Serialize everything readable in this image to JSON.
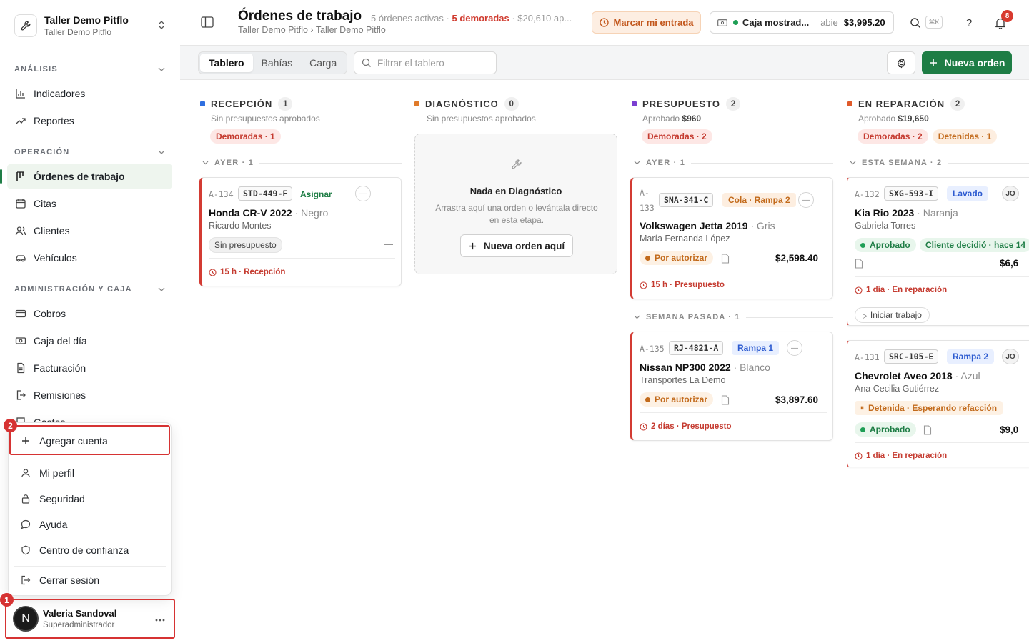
{
  "workspace": {
    "name": "Taller Demo Pitflo",
    "sub": "Taller Demo Pitflo"
  },
  "sidebar": {
    "sections": [
      {
        "label": "ANÁLISIS"
      },
      {
        "label": "OPERACIÓN"
      },
      {
        "label": "ADMINISTRACIÓN Y CAJA"
      }
    ],
    "items": [
      {
        "label": "Indicadores",
        "icon": "chart-icon"
      },
      {
        "label": "Reportes",
        "icon": "trend-icon"
      },
      {
        "label": "Órdenes de trabajo",
        "icon": "kanban-icon",
        "active": true
      },
      {
        "label": "Citas",
        "icon": "calendar-icon"
      },
      {
        "label": "Clientes",
        "icon": "users-icon"
      },
      {
        "label": "Vehículos",
        "icon": "car-icon"
      },
      {
        "label": "Cobros",
        "icon": "card-icon"
      },
      {
        "label": "Caja del día",
        "icon": "cash-icon"
      },
      {
        "label": "Facturación",
        "icon": "file-icon"
      },
      {
        "label": "Remisiones",
        "icon": "export-icon"
      },
      {
        "label": "Gastos",
        "icon": "receipt-icon"
      }
    ]
  },
  "account_menu": {
    "add_account": "Agregar cuenta",
    "items": [
      "Mi perfil",
      "Seguridad",
      "Ayuda",
      "Centro de confianza"
    ],
    "logout": "Cerrar sesión"
  },
  "user": {
    "initial": "N",
    "name": "Valeria Sandoval",
    "role": "Superadministrador"
  },
  "annotations": {
    "first": "1",
    "second": "2"
  },
  "header": {
    "title": "Órdenes de trabajo",
    "breadcrumb": "Taller Demo Pitflo › Taller Demo Pitflo",
    "active": "5 órdenes activas",
    "sep": "·",
    "late": "5 demoradas",
    "amount": "$20,610 ap...",
    "entry_button": "Marcar mi entrada",
    "caja_label": "Caja mostrad...",
    "caja_state": "abie",
    "caja_amount": "$3,995.20",
    "shortcut": "⌘K",
    "notifications": "8"
  },
  "toolbar": {
    "tabs": [
      "Tablero",
      "Bahías",
      "Carga"
    ],
    "filter_placeholder": "Filtrar el tablero",
    "new_order": "Nueva orden"
  },
  "columns": {
    "reception": {
      "title": "RECEPCIÓN",
      "count": "1",
      "subtitle": "Sin presupuestos aprobados",
      "late_pill": "Demoradas · 1",
      "group": "AYER · 1",
      "card": {
        "id": "A-134",
        "plate": "STD-449-F",
        "assign": "Asignar",
        "car": "Honda CR-V 2022",
        "color": "· Negro",
        "owner": "Ricardo Montes",
        "status": "Sin presupuesto",
        "dash": "—",
        "footer": "15 h · Recepción"
      }
    },
    "diagnosis": {
      "title": "DIAGNÓSTICO",
      "count": "0",
      "subtitle": "Sin presupuestos aprobados",
      "empty_title": "Nada en Diagnóstico",
      "empty_desc": "Arrastra aquí una orden o levántala directo en esta etapa.",
      "empty_button": "Nueva orden aquí"
    },
    "budget": {
      "title": "PRESUPUESTO",
      "count": "2",
      "subtitle_label": "Aprobado",
      "subtitle_value": "$960",
      "late_pill": "Demoradas · 2",
      "group1": "AYER · 1",
      "group2": "SEMANA PASADA · 1",
      "card1": {
        "id1": "A-",
        "id2": "133",
        "plate": "SNA-341-C",
        "tag": "Cola · Rampa 2",
        "car": "Volkswagen Jetta 2019",
        "color": "· Gris",
        "owner": "María Fernanda López",
        "status": "Por autorizar",
        "price": "$2,598.40",
        "footer": "15 h · Presupuesto"
      },
      "card2": {
        "id": "A-135",
        "plate": "RJ-4821-A",
        "tag": "Rampa 1",
        "car": "Nissan NP300 2022",
        "color": "· Blanco",
        "owner": "Transportes La Demo",
        "status": "Por autorizar",
        "price": "$3,897.60",
        "footer": "2 días · Presupuesto"
      }
    },
    "repair": {
      "title": "EN REPARACIÓN",
      "count": "2",
      "subtitle_label": "Aprobado",
      "subtitle_value": "$19,650",
      "late_pill": "Demoradas · 2",
      "held_pill": "Detenidas · 1",
      "group": "ESTA SEMANA · 2",
      "card1": {
        "id": "A-132",
        "plate": "SXG-593-I",
        "tag": "Lavado",
        "avatar": "JO",
        "car": "Kia Rio 2023",
        "color": "· Naranja",
        "owner": "Gabriela Torres",
        "status": "Aprobado",
        "decision": "Cliente decidió · hace 14",
        "price": "$6,6",
        "footer": "1 día · En reparación",
        "action": "Iniciar trabajo"
      },
      "card2": {
        "id": "A-131",
        "plate": "SRC-105-E",
        "tag": "Rampa 2",
        "avatar": "JO",
        "car": "Chevrolet Aveo 2018",
        "color": "· Azul",
        "owner": "Ana Cecilia Gutiérrez",
        "held": "Detenida · Esperando refacción",
        "status": "Aprobado",
        "price": "$9,0",
        "footer": "1 día · En reparación"
      }
    }
  },
  "colors": {
    "accent": "#1e7d45",
    "late": "#d33b33",
    "reception": "#2f6fe0",
    "diagnosis": "#e07a2a",
    "budget": "#7b3fd1",
    "repair": "#e05a2a"
  }
}
